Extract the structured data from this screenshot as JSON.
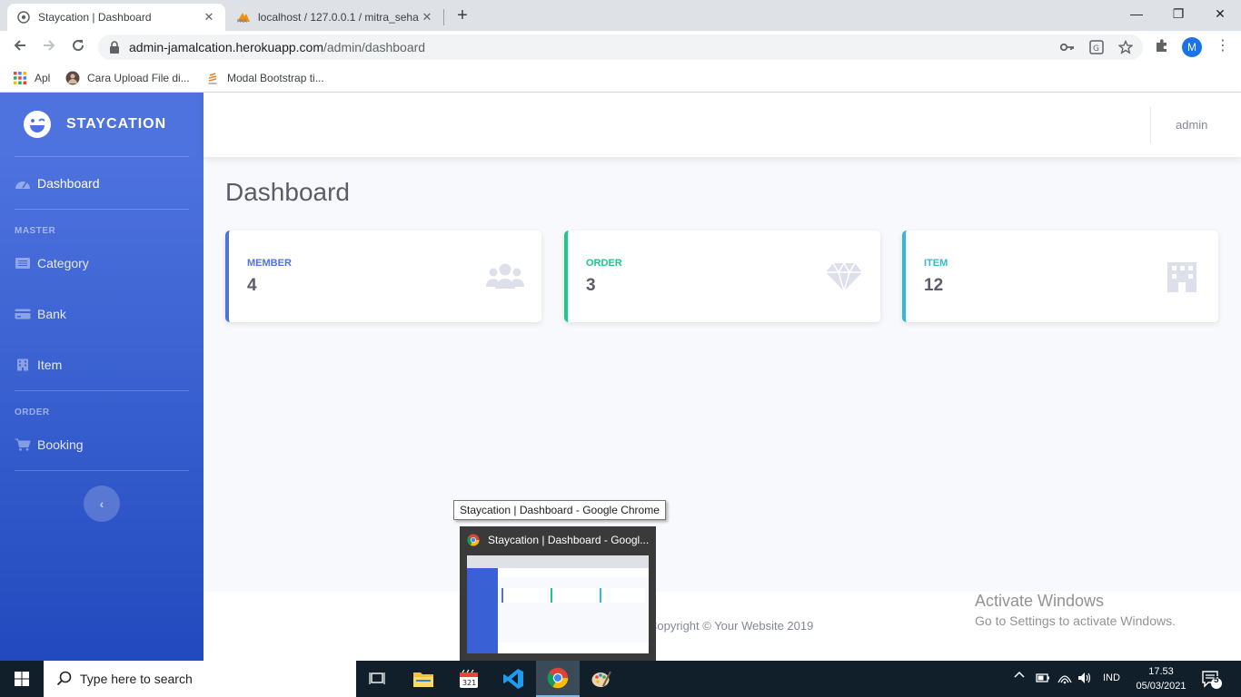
{
  "browser": {
    "tabs": [
      {
        "title": "Staycation | Dashboard",
        "active": true
      },
      {
        "title": "localhost / 127.0.0.1 / mitra_seha",
        "active": false
      }
    ],
    "new_tab": "+",
    "window_controls": {
      "minimize": "—",
      "maximize": "❐",
      "close": "✕"
    },
    "url_host": "admin-jamalcation.herokuapp.com",
    "url_path": "/admin/dashboard",
    "profile_initial": "M",
    "bookmarks": [
      {
        "label": "Apl",
        "icon": "apps-grid-icon"
      },
      {
        "label": "Cara Upload File di...",
        "icon": "avatar-icon"
      },
      {
        "label": "Modal Bootstrap ti...",
        "icon": "stack-icon"
      }
    ]
  },
  "sidebar": {
    "brand": "STAYCATION",
    "items": [
      {
        "label": "Dashboard",
        "icon": "tachometer-icon"
      },
      {
        "label": "Category",
        "icon": "list-icon"
      },
      {
        "label": "Bank",
        "icon": "credit-card-icon"
      },
      {
        "label": "Item",
        "icon": "building-icon"
      },
      {
        "label": "Booking",
        "icon": "cart-icon"
      }
    ],
    "headings": {
      "master": "MASTER",
      "order": "ORDER"
    },
    "toggle": "‹"
  },
  "topbar": {
    "user": "admin"
  },
  "main": {
    "title": "Dashboard",
    "cards": [
      {
        "label": "MEMBER",
        "value": "4",
        "color": "#4e73df",
        "icon": "users-icon"
      },
      {
        "label": "ORDER",
        "value": "3",
        "color": "#1cc88a",
        "icon": "gem-icon"
      },
      {
        "label": "ITEM",
        "value": "12",
        "color": "#36b9cc",
        "icon": "building-icon"
      }
    ]
  },
  "footer": {
    "copyright": "Copyright © Your Website 2019"
  },
  "activate": {
    "title": "Activate Windows",
    "subtitle": "Go to Settings to activate Windows."
  },
  "tooltip": {
    "text": "Staycation | Dashboard - Google Chrome"
  },
  "thumbnail": {
    "title": "Staycation | Dashboard - Googl..."
  },
  "taskbar": {
    "search_placeholder": "Type here to search",
    "language": "IND",
    "time": "17.53",
    "date": "05/03/2021",
    "notifications": "5"
  },
  "colors": {
    "sidebar_top": "#4e73df",
    "sidebar_bottom": "#224abe",
    "page_bg": "#f8f9fc",
    "taskbar": "#101f2a"
  }
}
